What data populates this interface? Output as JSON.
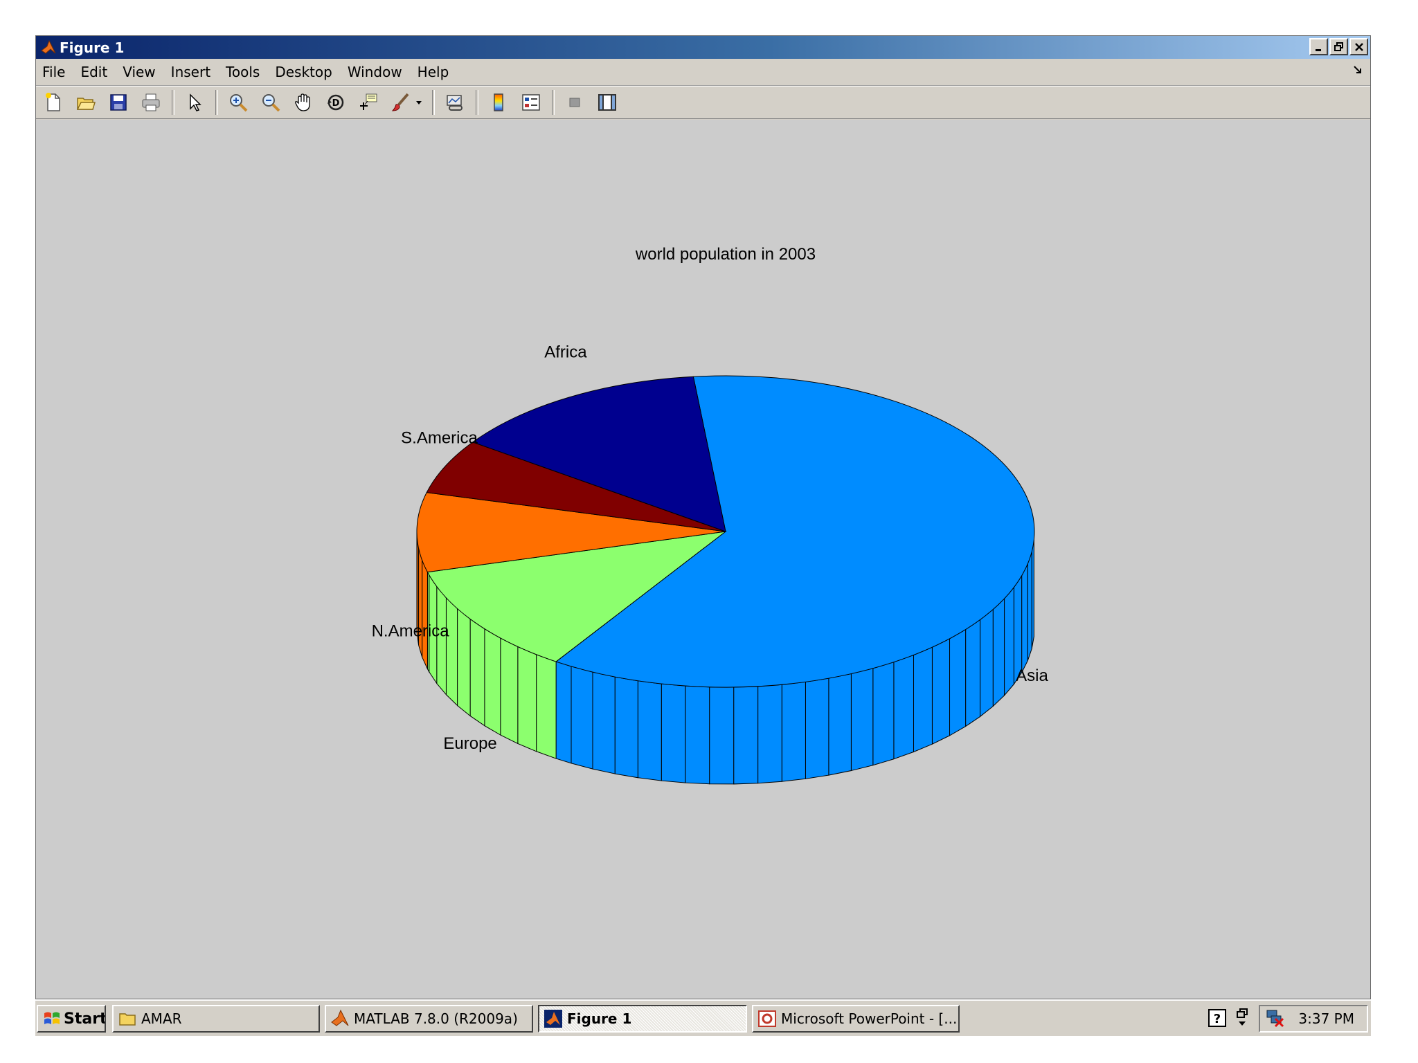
{
  "window": {
    "title": "Figure 1"
  },
  "menu": [
    "File",
    "Edit",
    "View",
    "Insert",
    "Tools",
    "Desktop",
    "Window",
    "Help"
  ],
  "toolbar_icons": [
    "new-file-icon",
    "open-folder-icon",
    "save-icon",
    "print-icon",
    "pointer-icon",
    "zoom-in-icon",
    "zoom-out-icon",
    "pan-hand-icon",
    "rotate-3d-icon",
    "data-cursor-icon",
    "brush-icon",
    "link-plot-icon",
    "colorbar-icon",
    "legend-icon",
    "hide-plot-tools-icon",
    "show-plot-tools-icon"
  ],
  "chart_data": {
    "type": "pie",
    "style": "3d",
    "title": "world population in 2003",
    "slices": [
      {
        "label": "Asia",
        "value": 3850,
        "color": "#008cff"
      },
      {
        "label": "Europe",
        "value": 730,
        "color": "#8cff6e"
      },
      {
        "label": "N.America",
        "value": 520,
        "color": "#ff6f00"
      },
      {
        "label": "S.America",
        "value": 360,
        "color": "#800000"
      },
      {
        "label": "Africa",
        "value": 860,
        "color": "#00008f"
      }
    ],
    "start_angle_deg": -96
  },
  "taskbar": {
    "start": "Start",
    "tasks": [
      "AMAR",
      "MATLAB  7.8.0 (R2009a)",
      "Figure 1",
      "Microsoft PowerPoint - [..."
    ],
    "clock": "3:37 PM"
  },
  "colors": {
    "titlebar_start": "#0a246a",
    "titlebar_end": "#a6caf0",
    "figure_bg": "#cccccc"
  }
}
